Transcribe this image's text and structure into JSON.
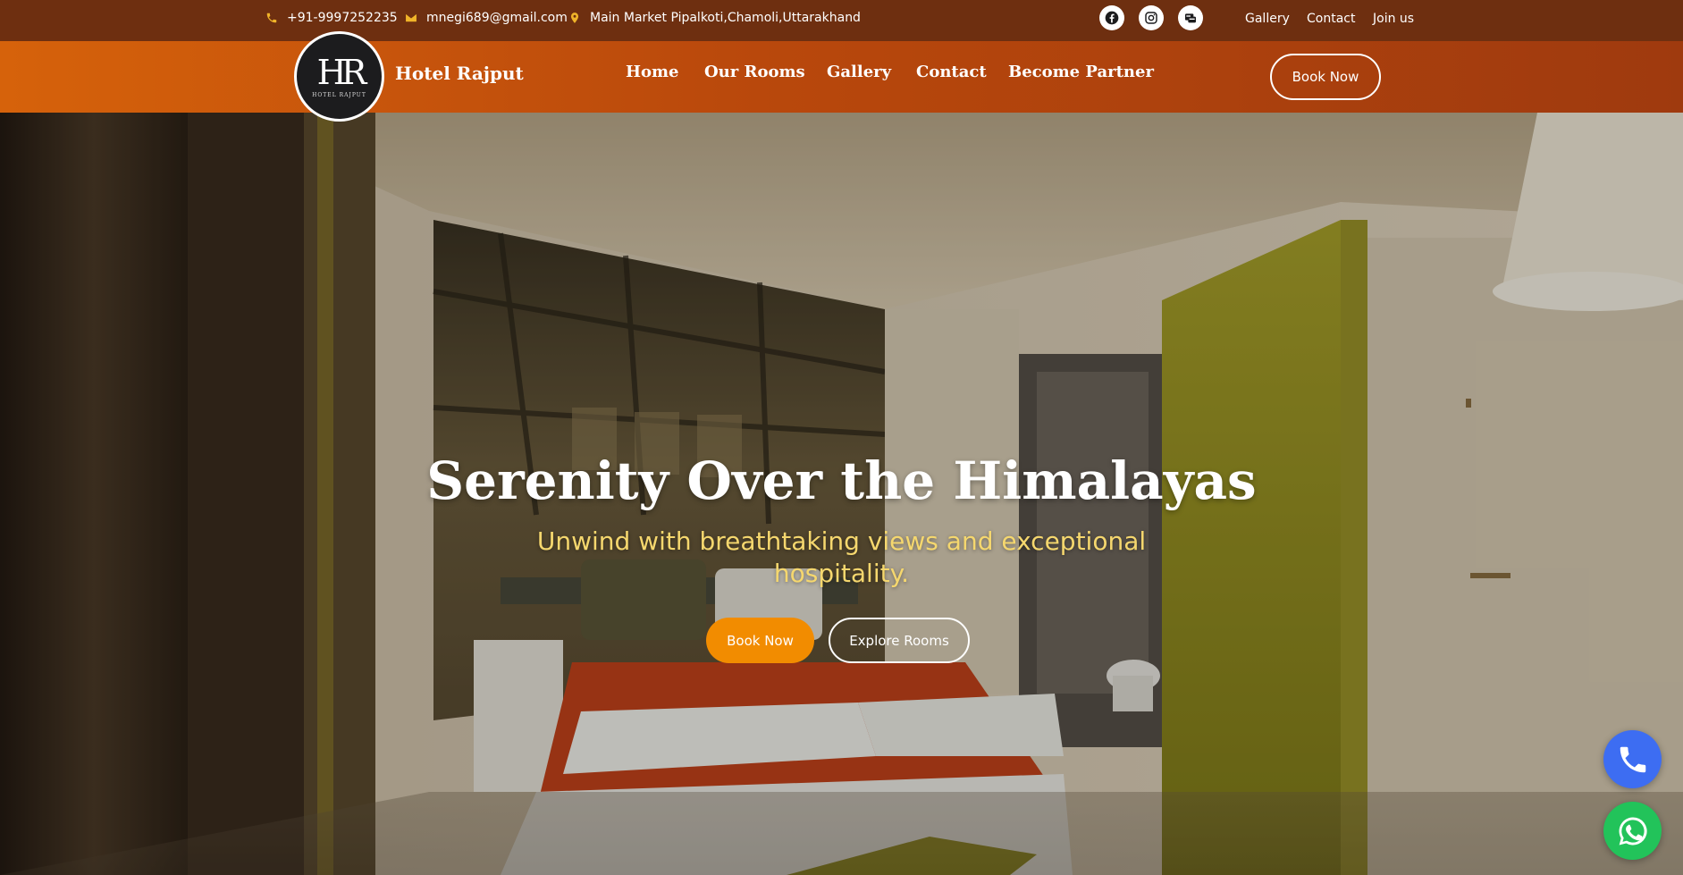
{
  "topbar": {
    "phone": "+91-9997252235",
    "email": "mnegi689@gmail.com",
    "address": "Main Market Pipalkoti,Chamoli,Uttarakhand",
    "social": [
      "facebook-icon",
      "instagram-icon",
      "booking-icon"
    ],
    "links": {
      "gallery": "Gallery",
      "contact": "Contact",
      "join": "Join us"
    }
  },
  "navbar": {
    "logo_monogram": "HR",
    "logo_text": "HOTEL RAJPUT",
    "brand": "Hotel Rajput",
    "menu": {
      "home": "Home",
      "rooms": "Our Rooms",
      "gallery": "Gallery",
      "contact": "Contact",
      "partner": "Become Partner"
    },
    "book_label": "Book Now"
  },
  "hero": {
    "title": "Serenity Over the Himalayas",
    "subtitle": "Unwind with breathtaking views and exceptional hospitality.",
    "book_label": "Book Now",
    "explore_label": "Explore Rooms"
  },
  "floating": [
    "phone-icon",
    "whatsapp-icon"
  ],
  "colors": {
    "topbar": "#6e2f10",
    "nav_start": "#d6620b",
    "nav_end": "#9f3a0e",
    "accent": "#f28c00",
    "subtitle": "#f5d76e",
    "call": "#3d6df2",
    "whatsapp": "#22c35a"
  }
}
